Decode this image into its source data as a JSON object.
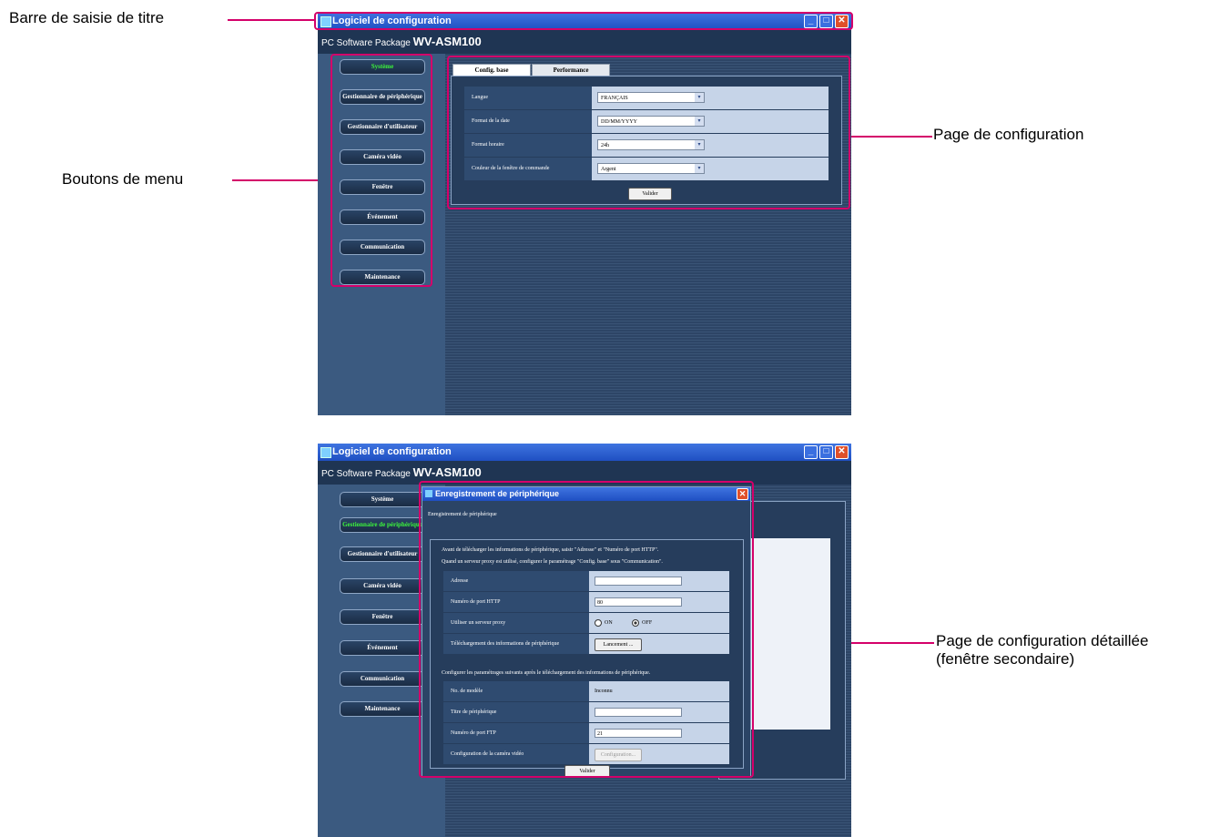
{
  "callouts": {
    "title_bar": "Barre de saisie de titre",
    "menu_buttons": "Boutons de menu",
    "config_page": "Page de configuration",
    "detail_page_line1": "Page de configuration détaillée",
    "detail_page_line2": "(fenêtre secondaire)"
  },
  "app": {
    "title": "Logiciel de configuration",
    "package_prefix": "PC Software Package",
    "package_model": "WV-ASM100"
  },
  "menu": {
    "items": [
      "Système",
      "Gestionnaire de périphérique",
      "Gestionnaire d'utilisateur",
      "Caméra vidéo",
      "Fenêtre",
      "Événement",
      "Communication",
      "Maintenance"
    ]
  },
  "config": {
    "tabs": [
      "Config. base",
      "Performance"
    ],
    "rows": [
      {
        "label": "Langue",
        "value": "FRANÇAIS"
      },
      {
        "label": "Format de la date",
        "value": "DD/MM/YYYY"
      },
      {
        "label": "Format horaire",
        "value": "24h"
      },
      {
        "label": "Couleur de la fenêtre de commande",
        "value": "Argent"
      }
    ],
    "submit": "Valider"
  },
  "subwindow": {
    "title": "Enregistrement de périphérique",
    "header": "Enregistrement de périphérique",
    "intro1": "Avant de télécharger les informations de périphérique, saisir \"Adresse\" et \"Numéro de port HTTP\".",
    "intro2": "Quand un serveur proxy est utilisé, configurer le paramétrage \"Config. base\" sous \"Communication\".",
    "address_label": "Adresse",
    "address_value": "",
    "http_label": "Numéro de port HTTP",
    "http_value": "80",
    "proxy_label": "Utiliser un serveur proxy",
    "proxy_on": "ON",
    "proxy_off": "OFF",
    "download_label": "Téléchargement des informations de périphérique",
    "download_button": "Lancement ...",
    "after_text": "Configurer les paramétrages suivants après le téléchargement des informations de périphérique.",
    "model_label": "No. de modèle",
    "model_value": "Inconnu",
    "device_title_label": "Titre de périphérique",
    "device_title_value": "",
    "ftp_label": "Numéro de port FTP",
    "ftp_value": "21",
    "camera_label": "Configuration de la caméra vidéo",
    "camera_button": "Configuration...",
    "submit": "Valider"
  },
  "glyphs": {
    "min": "_",
    "max": "□",
    "close": "✕",
    "arrow": "▾"
  }
}
